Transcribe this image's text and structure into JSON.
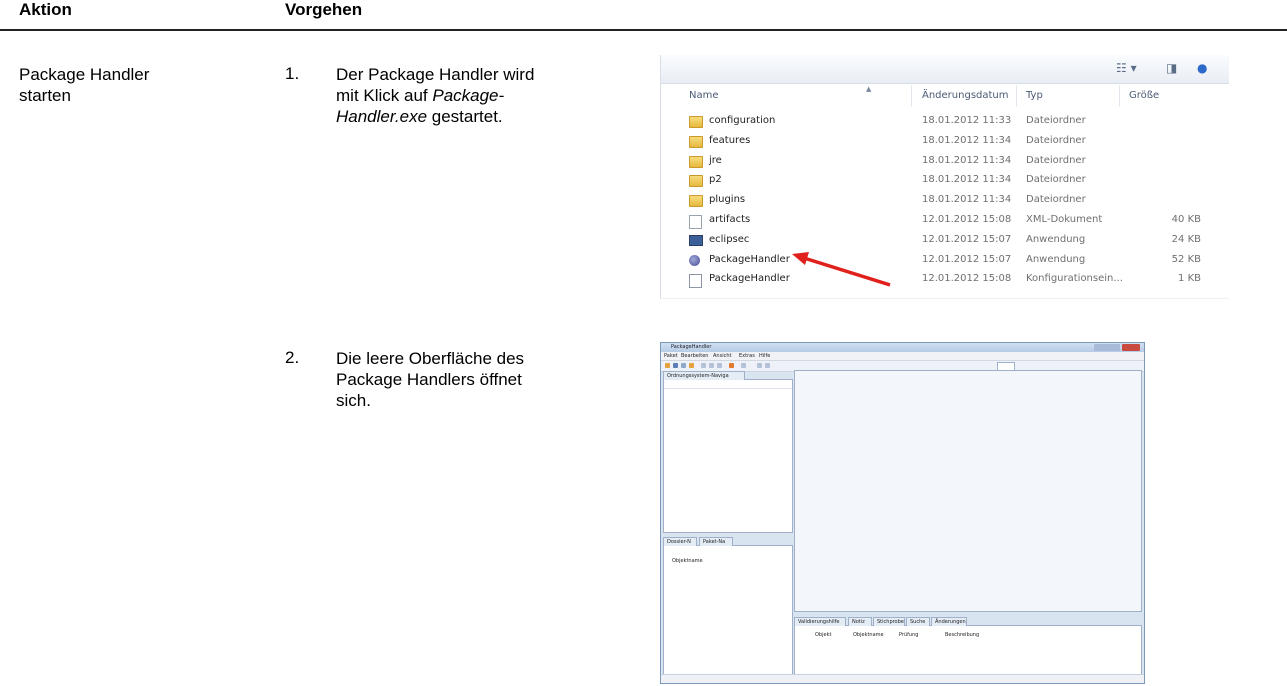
{
  "table": {
    "header_action": "Aktion",
    "header_procedure": "Vorgehen",
    "action_line1": "Package Handler",
    "action_line2": "starten"
  },
  "steps": [
    {
      "number": "1.",
      "line1": "Der Package Handler wird",
      "line2_prefix": "mit Klick auf ",
      "line2_italic": "Package-",
      "line3_italic": "Handler.exe",
      "line3_suffix": " gestartet."
    },
    {
      "number": "2.",
      "line1": "Die leere Oberfläche des",
      "line2": "Package Handlers öffnet",
      "line3": "sich."
    }
  ],
  "explorer": {
    "columns": {
      "name": "Name",
      "date": "Änderungsdatum",
      "type": "Typ",
      "size": "Größe"
    },
    "toolbar_icons": [
      "view-menu-icon",
      "preview-pane-icon",
      "help-icon"
    ],
    "files": [
      {
        "name": "configuration",
        "date": "18.01.2012 11:33",
        "type": "Dateiordner",
        "size": "",
        "icon": "folder-icon"
      },
      {
        "name": "features",
        "date": "18.01.2012 11:34",
        "type": "Dateiordner",
        "size": "",
        "icon": "folder-icon"
      },
      {
        "name": "jre",
        "date": "18.01.2012 11:34",
        "type": "Dateiordner",
        "size": "",
        "icon": "folder-icon"
      },
      {
        "name": "p2",
        "date": "18.01.2012 11:34",
        "type": "Dateiordner",
        "size": "",
        "icon": "folder-icon"
      },
      {
        "name": "plugins",
        "date": "18.01.2012 11:34",
        "type": "Dateiordner",
        "size": "",
        "icon": "folder-icon"
      },
      {
        "name": "artifacts",
        "date": "12.01.2012 15:08",
        "type": "XML-Dokument",
        "size": "40 KB",
        "icon": "xml-file-icon"
      },
      {
        "name": "eclipsec",
        "date": "12.01.2012 15:07",
        "type": "Anwendung",
        "size": "24 KB",
        "icon": "application-icon"
      },
      {
        "name": "PackageHandler",
        "date": "12.01.2012 15:07",
        "type": "Anwendung",
        "size": "52 KB",
        "icon": "packagehandler-app-icon"
      },
      {
        "name": "PackageHandler",
        "date": "12.01.2012 15:08",
        "type": "Konfigurationsein...",
        "size": "1 KB",
        "icon": "config-file-icon"
      }
    ],
    "arrow_color": "#e0201c"
  },
  "app_window": {
    "title": "PackageHandler",
    "menu": [
      "Paket",
      "Bearbeiten",
      "Ansicht",
      "Extras",
      "Hilfe"
    ],
    "navigator_tab": "Ordnungssystem-Naviga",
    "dossier_tab": "Dossier-N",
    "paket_tab": "Paket-Na",
    "objektname_header": "Objektname",
    "bottom_tabs": [
      "Validierungshilfe",
      "Notiz",
      "Stichprobe",
      "Suche",
      "Änderungen"
    ],
    "bottom_columns": [
      "Objekt",
      "Objektname",
      "Prüfung",
      "Beschreibung"
    ]
  }
}
